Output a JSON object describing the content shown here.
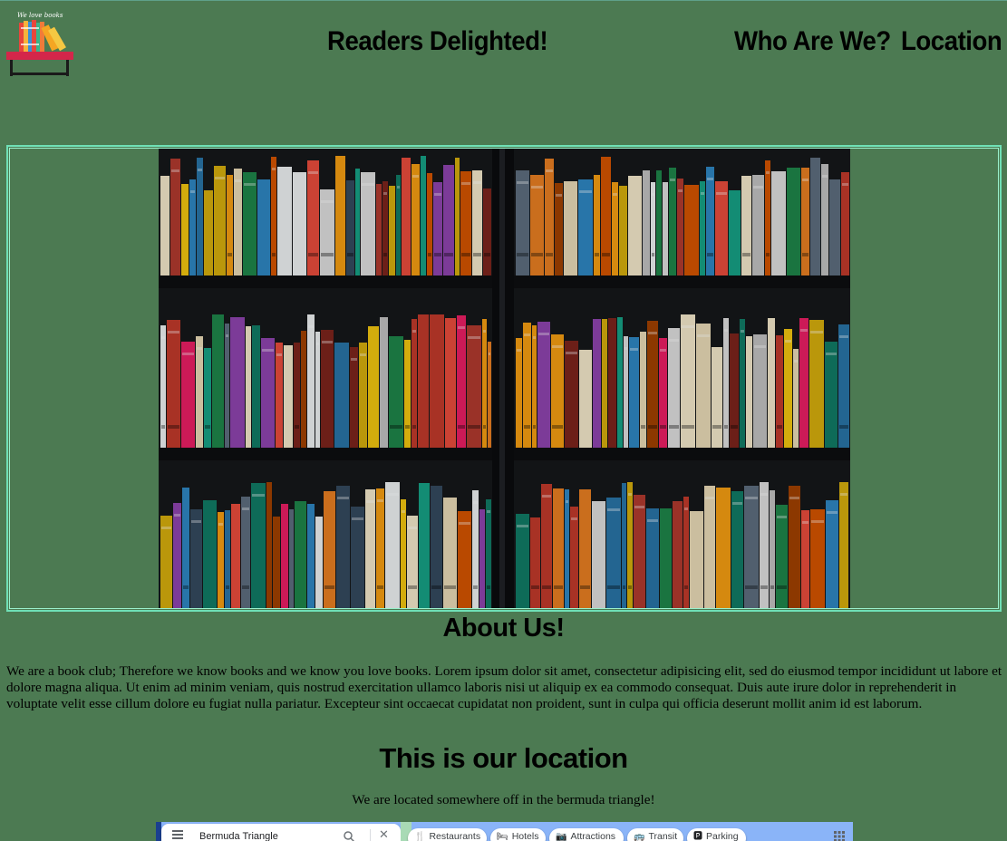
{
  "header": {
    "logo_text": "We love books",
    "nav": {
      "delighted": "Readers Delighted!",
      "who": "Who Are We?",
      "location": "Location"
    }
  },
  "hero": {
    "image": "bookshelf-photo"
  },
  "about": {
    "title": "About Us!",
    "body": "We are a book club; Therefore we know books and we know you love books. Lorem ipsum dolor sit amet, consectetur adipisicing elit, sed do eiusmod tempor incididunt ut labore et dolore magna aliqua. Ut enim ad minim veniam, quis nostrud exercitation ullamco laboris nisi ut aliquip ex ea commodo consequat. Duis aute irure dolor in reprehenderit in voluptate velit esse cillum dolore eu fugiat nulla pariatur. Excepteur sint occaecat cupidatat non proident, sunt in culpa qui officia deserunt mollit anim id est laborum."
  },
  "location": {
    "title": "This is our location",
    "text": "We are located somewhere off in the bermuda triangle!"
  },
  "map": {
    "search_value": "Bermuda Triangle",
    "chips": {
      "restaurants": "Restaurants",
      "hotels": "Hotels",
      "attractions": "Attractions",
      "transit": "Transit",
      "parking": "Parking"
    }
  },
  "colors": {
    "page_background": "#4c7a52",
    "frame_border": "#6fe0b6",
    "map_water": "#8ab4f8"
  }
}
